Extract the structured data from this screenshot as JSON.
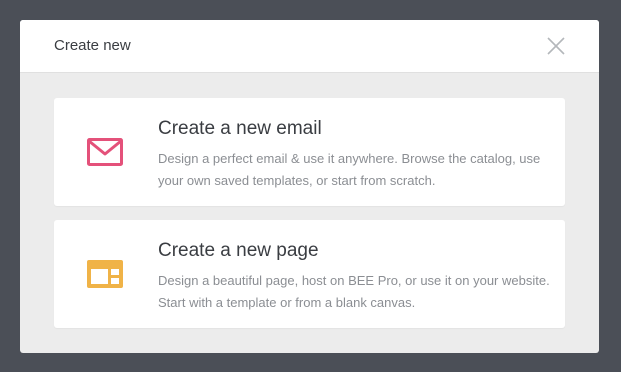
{
  "dialog": {
    "title": "Create new",
    "close_icon": "close-icon"
  },
  "options": [
    {
      "title": "Create a new email",
      "description": "Design a perfect email & use it anywhere. Browse the catalog, use your own saved templates, or start from scratch.",
      "icon": "envelope-icon",
      "icon_color": "#e4517a"
    },
    {
      "title": "Create a new page",
      "description": "Design a beautiful page, host on BEE Pro, or use it on your website. Start with a template or from a blank canvas.",
      "icon": "webpage-icon",
      "icon_color": "#f0b347"
    }
  ],
  "colors": {
    "backdrop": "#4b4f57",
    "dialog_body": "#ececec",
    "card": "#ffffff"
  }
}
